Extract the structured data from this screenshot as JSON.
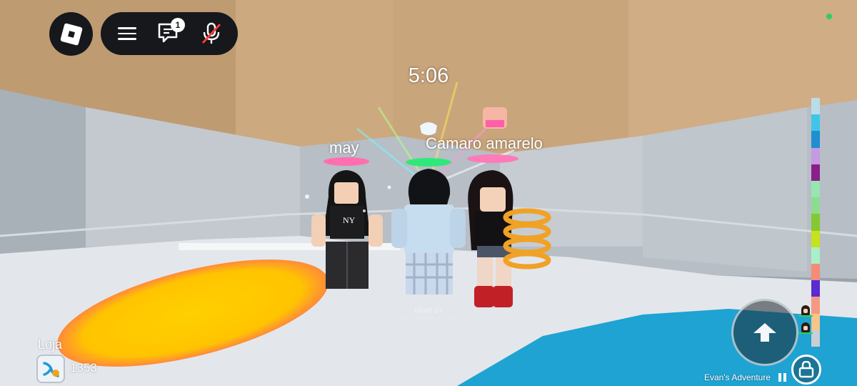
{
  "hud": {
    "notification_count": "1",
    "timer": "5:06"
  },
  "players": {
    "left_name": "may",
    "center_name": "Camaro amarelo",
    "level_text": "Nível 67",
    "level_subtext": "1 Pontos de Habilidade não utilizados"
  },
  "shop": {
    "label": "Loja",
    "coins": "1353"
  },
  "footer": {
    "game_title": "Evan's Adventure"
  },
  "color_column": [
    "#b9dde8",
    "#3ec6e8",
    "#1e8fd0",
    "#c59ae0",
    "#8a1f8a",
    "#96e6b0",
    "#8ddc8e",
    "#85c832",
    "#c6e21a",
    "#a8f0c8",
    "#f48c78",
    "#5a2bd0",
    "#f49a84",
    "#f7c48a",
    "#c9ced4"
  ],
  "colors": {
    "ceiling": "#c8a47c",
    "floor": "#e4e8ec",
    "hud_bg": "#16181b",
    "glow_pad": "#ffc400",
    "water": "#20a4d4",
    "status_green": "#2bd15a"
  }
}
